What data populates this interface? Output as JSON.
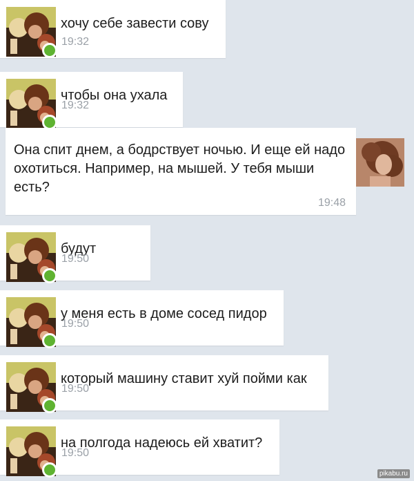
{
  "messages": [
    {
      "text": "хочу себе завести сову",
      "time": "19:32"
    },
    {
      "text": "чтобы она ухала",
      "time": "19:32"
    },
    {
      "text_lines": [
        "Она спит днем, а бодрствует ночью. И еще ей надо",
        "охотиться. Например, на мышей. У тебя мыши",
        "есть?"
      ],
      "time": "19:48"
    },
    {
      "text": "будут",
      "time": "19:50"
    },
    {
      "text": "у меня есть в доме сосед пидор",
      "time": "19:50"
    },
    {
      "text": "который машину ставит хуй пойми как",
      "time": "19:50"
    },
    {
      "text": "на полгода надеюсь ей хватит?",
      "time": "19:50"
    }
  ],
  "watermark": "pikabu.ru",
  "colors": {
    "background": "#dfe5ec",
    "bubble": "#ffffff",
    "text": "#1c1c1c",
    "time": "#9aa0a7",
    "online": "#5fb331"
  },
  "icons": [
    "user-avatar-photo",
    "online-status-dot",
    "contact-avatar-photo"
  ]
}
